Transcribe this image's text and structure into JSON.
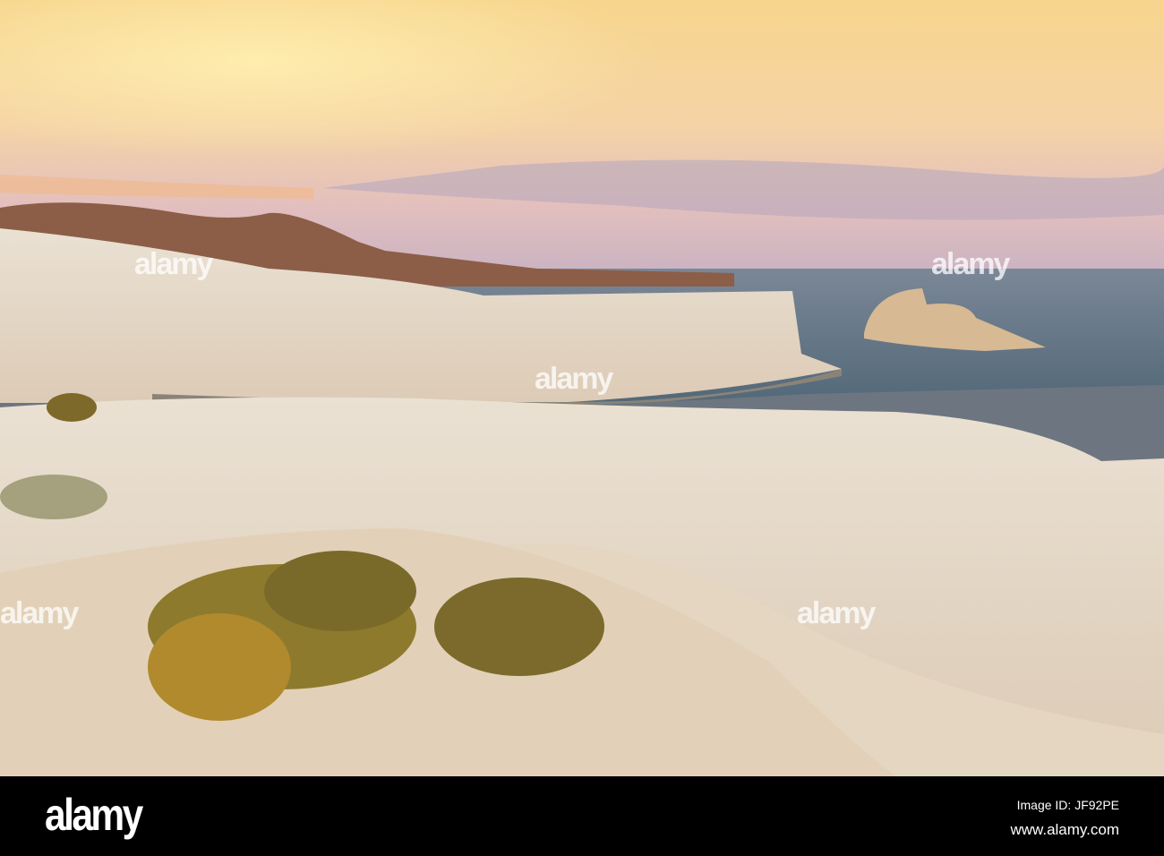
{
  "scene": {
    "description_label": "Sarakiniko white rock coast at sunset",
    "colors": {
      "sky_top": "#f6d08a",
      "sky_mid": "#f3c7a4",
      "sky_low": "#d7b6c4",
      "sea": "#4f6778",
      "rock": "#e6dccd",
      "bush": "#8c7a2a"
    }
  },
  "watermark": {
    "text": "alamy"
  },
  "footer": {
    "logo": "alamy",
    "image_id": "Image ID: JF92PE",
    "website": "www.alamy.com"
  }
}
